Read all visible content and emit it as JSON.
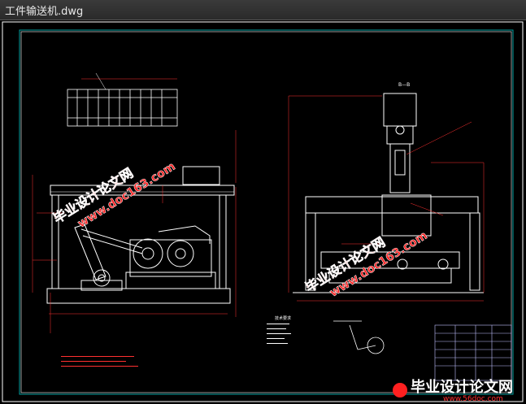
{
  "window": {
    "title": "工件输送机.dwg"
  },
  "drawing": {
    "section_label": "B—B",
    "note_label": "技术要求"
  },
  "watermarks": {
    "cn": "毕业设计论文网",
    "url": "www.doc163.com"
  },
  "footer_logo": {
    "cn": "毕业设计论文网",
    "url": "www.56doc.com"
  },
  "colors": {
    "background": "#000000",
    "frame": "#ffffff",
    "inner_frame": "#00a0a0",
    "lines": "#ffffff",
    "dims": "#ff3030",
    "centerline": "#ff3030",
    "hatch": "#ff3030",
    "watermark": "#ff2020",
    "watermark_stroke": "#ffffff",
    "titleblock": "#c0c0ff"
  }
}
